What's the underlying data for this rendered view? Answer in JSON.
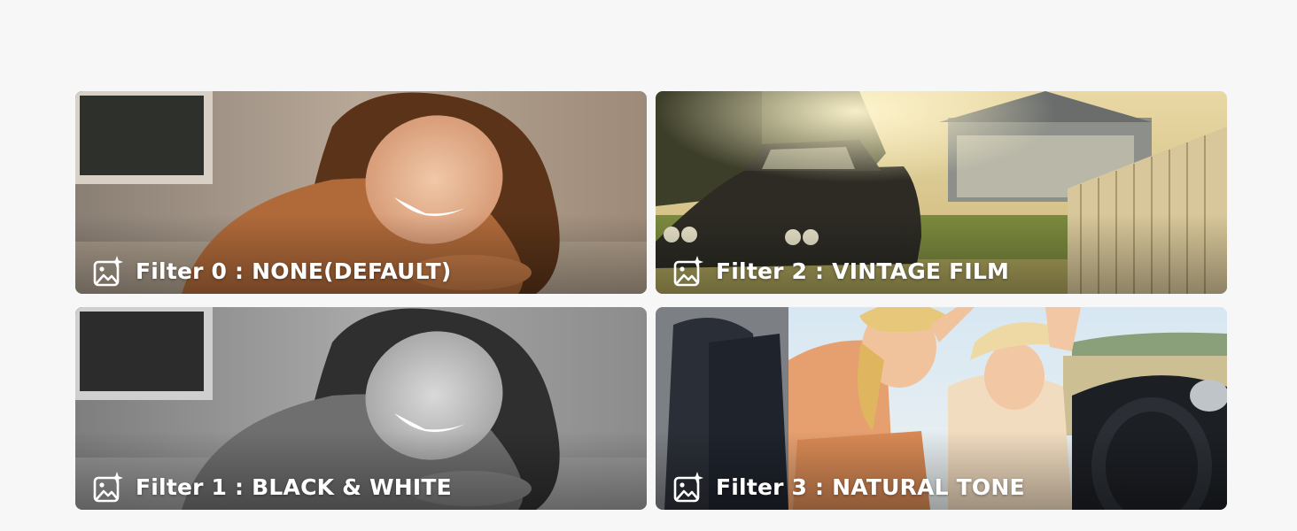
{
  "filters": [
    {
      "label": "Filter 0 : NONE(DEFAULT)",
      "icon": "image-sparkle-icon"
    },
    {
      "label": "Filter 2 : VINTAGE FILM",
      "icon": "image-sparkle-icon"
    },
    {
      "label": "Filter 1 : BLACK & WHITE",
      "icon": "image-sparkle-icon"
    },
    {
      "label": "Filter 3 : NATURAL TONE",
      "icon": "image-sparkle-icon"
    }
  ]
}
